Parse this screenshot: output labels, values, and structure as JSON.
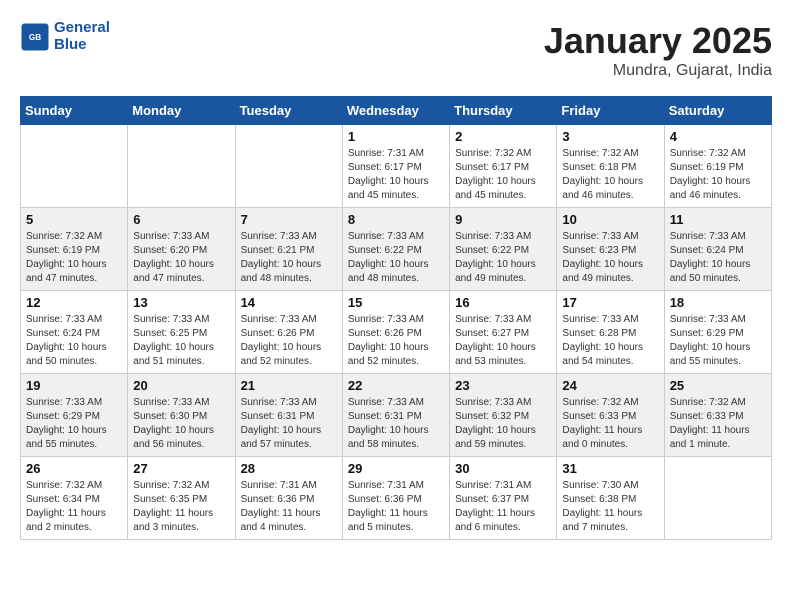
{
  "header": {
    "logo_line1": "General",
    "logo_line2": "Blue",
    "title": "January 2025",
    "subtitle": "Mundra, Gujarat, India"
  },
  "days_of_week": [
    "Sunday",
    "Monday",
    "Tuesday",
    "Wednesday",
    "Thursday",
    "Friday",
    "Saturday"
  ],
  "weeks": [
    [
      {
        "day": "",
        "info": ""
      },
      {
        "day": "",
        "info": ""
      },
      {
        "day": "",
        "info": ""
      },
      {
        "day": "1",
        "info": "Sunrise: 7:31 AM\nSunset: 6:17 PM\nDaylight: 10 hours\nand 45 minutes."
      },
      {
        "day": "2",
        "info": "Sunrise: 7:32 AM\nSunset: 6:17 PM\nDaylight: 10 hours\nand 45 minutes."
      },
      {
        "day": "3",
        "info": "Sunrise: 7:32 AM\nSunset: 6:18 PM\nDaylight: 10 hours\nand 46 minutes."
      },
      {
        "day": "4",
        "info": "Sunrise: 7:32 AM\nSunset: 6:19 PM\nDaylight: 10 hours\nand 46 minutes."
      }
    ],
    [
      {
        "day": "5",
        "info": "Sunrise: 7:32 AM\nSunset: 6:19 PM\nDaylight: 10 hours\nand 47 minutes."
      },
      {
        "day": "6",
        "info": "Sunrise: 7:33 AM\nSunset: 6:20 PM\nDaylight: 10 hours\nand 47 minutes."
      },
      {
        "day": "7",
        "info": "Sunrise: 7:33 AM\nSunset: 6:21 PM\nDaylight: 10 hours\nand 48 minutes."
      },
      {
        "day": "8",
        "info": "Sunrise: 7:33 AM\nSunset: 6:22 PM\nDaylight: 10 hours\nand 48 minutes."
      },
      {
        "day": "9",
        "info": "Sunrise: 7:33 AM\nSunset: 6:22 PM\nDaylight: 10 hours\nand 49 minutes."
      },
      {
        "day": "10",
        "info": "Sunrise: 7:33 AM\nSunset: 6:23 PM\nDaylight: 10 hours\nand 49 minutes."
      },
      {
        "day": "11",
        "info": "Sunrise: 7:33 AM\nSunset: 6:24 PM\nDaylight: 10 hours\nand 50 minutes."
      }
    ],
    [
      {
        "day": "12",
        "info": "Sunrise: 7:33 AM\nSunset: 6:24 PM\nDaylight: 10 hours\nand 50 minutes."
      },
      {
        "day": "13",
        "info": "Sunrise: 7:33 AM\nSunset: 6:25 PM\nDaylight: 10 hours\nand 51 minutes."
      },
      {
        "day": "14",
        "info": "Sunrise: 7:33 AM\nSunset: 6:26 PM\nDaylight: 10 hours\nand 52 minutes."
      },
      {
        "day": "15",
        "info": "Sunrise: 7:33 AM\nSunset: 6:26 PM\nDaylight: 10 hours\nand 52 minutes."
      },
      {
        "day": "16",
        "info": "Sunrise: 7:33 AM\nSunset: 6:27 PM\nDaylight: 10 hours\nand 53 minutes."
      },
      {
        "day": "17",
        "info": "Sunrise: 7:33 AM\nSunset: 6:28 PM\nDaylight: 10 hours\nand 54 minutes."
      },
      {
        "day": "18",
        "info": "Sunrise: 7:33 AM\nSunset: 6:29 PM\nDaylight: 10 hours\nand 55 minutes."
      }
    ],
    [
      {
        "day": "19",
        "info": "Sunrise: 7:33 AM\nSunset: 6:29 PM\nDaylight: 10 hours\nand 55 minutes."
      },
      {
        "day": "20",
        "info": "Sunrise: 7:33 AM\nSunset: 6:30 PM\nDaylight: 10 hours\nand 56 minutes."
      },
      {
        "day": "21",
        "info": "Sunrise: 7:33 AM\nSunset: 6:31 PM\nDaylight: 10 hours\nand 57 minutes."
      },
      {
        "day": "22",
        "info": "Sunrise: 7:33 AM\nSunset: 6:31 PM\nDaylight: 10 hours\nand 58 minutes."
      },
      {
        "day": "23",
        "info": "Sunrise: 7:33 AM\nSunset: 6:32 PM\nDaylight: 10 hours\nand 59 minutes."
      },
      {
        "day": "24",
        "info": "Sunrise: 7:32 AM\nSunset: 6:33 PM\nDaylight: 11 hours\nand 0 minutes."
      },
      {
        "day": "25",
        "info": "Sunrise: 7:32 AM\nSunset: 6:33 PM\nDaylight: 11 hours\nand 1 minute."
      }
    ],
    [
      {
        "day": "26",
        "info": "Sunrise: 7:32 AM\nSunset: 6:34 PM\nDaylight: 11 hours\nand 2 minutes."
      },
      {
        "day": "27",
        "info": "Sunrise: 7:32 AM\nSunset: 6:35 PM\nDaylight: 11 hours\nand 3 minutes."
      },
      {
        "day": "28",
        "info": "Sunrise: 7:31 AM\nSunset: 6:36 PM\nDaylight: 11 hours\nand 4 minutes."
      },
      {
        "day": "29",
        "info": "Sunrise: 7:31 AM\nSunset: 6:36 PM\nDaylight: 11 hours\nand 5 minutes."
      },
      {
        "day": "30",
        "info": "Sunrise: 7:31 AM\nSunset: 6:37 PM\nDaylight: 11 hours\nand 6 minutes."
      },
      {
        "day": "31",
        "info": "Sunrise: 7:30 AM\nSunset: 6:38 PM\nDaylight: 11 hours\nand 7 minutes."
      },
      {
        "day": "",
        "info": ""
      }
    ]
  ]
}
